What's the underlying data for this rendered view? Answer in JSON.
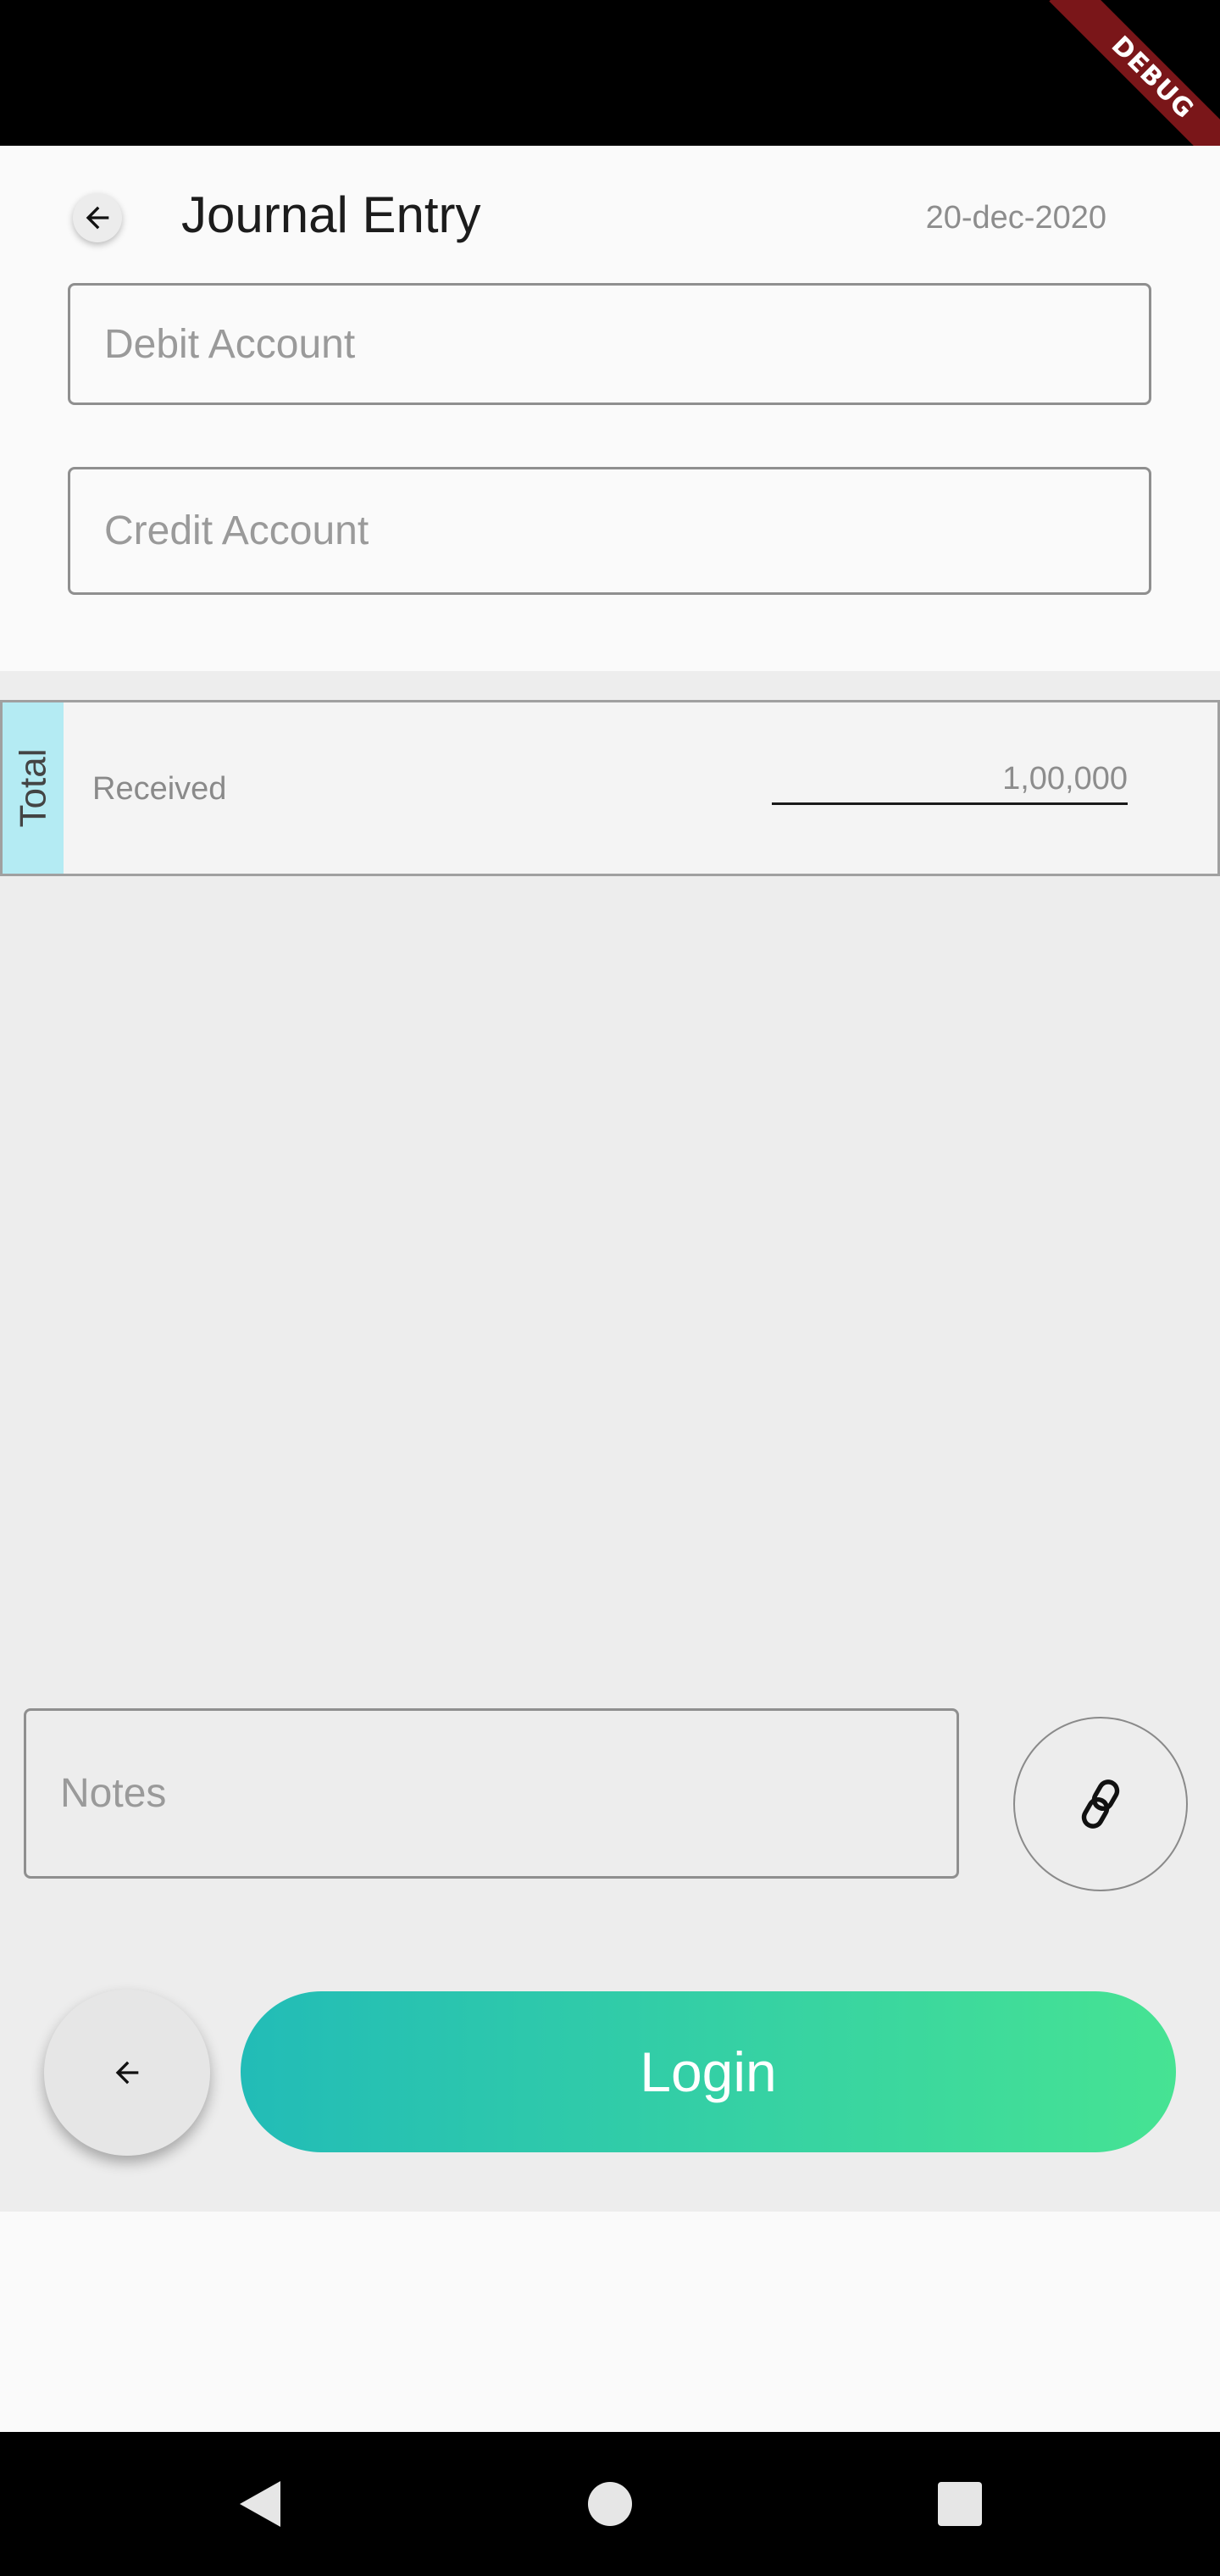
{
  "status_bar": {
    "debug_label": "DEBUG"
  },
  "header": {
    "title": "Journal Entry",
    "date": "20-dec-2020"
  },
  "form": {
    "debit_placeholder": "Debit Account",
    "credit_placeholder": "Credit Account"
  },
  "total": {
    "tab_label": "Total",
    "received_label": "Received",
    "received_value": "1,00,000"
  },
  "notes": {
    "placeholder": "Notes"
  },
  "actions": {
    "login_label": "Login"
  },
  "icons": {
    "back": "arrow-left-icon",
    "attach": "link-icon",
    "nav_back": "triangle-back-icon",
    "nav_home": "circle-home-icon",
    "nav_recents": "square-recents-icon"
  },
  "colors": {
    "login_gradient_start": "#22bcb7",
    "login_gradient_end": "#46e393",
    "total_tab": "#b4ebf3",
    "debug_ribbon": "#7a1619"
  }
}
